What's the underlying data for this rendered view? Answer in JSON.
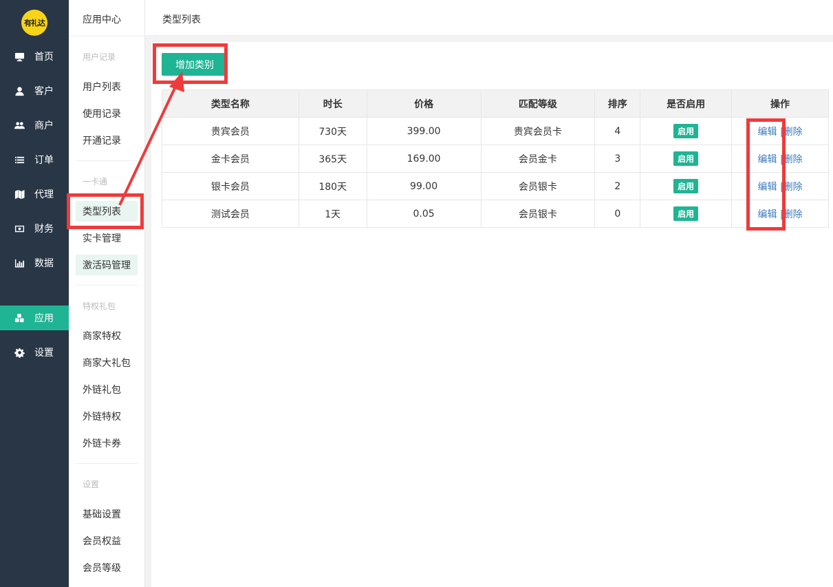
{
  "logo_text": "有礼达",
  "nav": {
    "items": [
      {
        "label": "首页",
        "icon": "monitor-icon"
      },
      {
        "label": "客户",
        "icon": "user-icon"
      },
      {
        "label": "商户",
        "icon": "users-icon"
      },
      {
        "label": "订单",
        "icon": "list-icon"
      },
      {
        "label": "代理",
        "icon": "map-icon"
      },
      {
        "label": "财务",
        "icon": "money-icon"
      },
      {
        "label": "数据",
        "icon": "bar-chart-icon"
      },
      {
        "label": "应用",
        "icon": "cubes-icon"
      },
      {
        "label": "设置",
        "icon": "gear-icon"
      }
    ]
  },
  "submenu": {
    "title": "应用中心",
    "groups": {
      "user_records": "用户记录",
      "card": "一卡通",
      "privilege": "特权礼包",
      "settings": "设置"
    },
    "items": [
      "用户列表",
      "使用记录",
      "开通记录",
      "类型列表",
      "实卡管理",
      "激活码管理",
      "商家特权",
      "商家大礼包",
      "外链礼包",
      "外链特权",
      "外链卡券",
      "基础设置",
      "会员权益",
      "会员等级"
    ]
  },
  "topbar": {
    "title": "类型列表"
  },
  "add_button": "增加类别",
  "table": {
    "headers": [
      "类型名称",
      "时长",
      "价格",
      "匹配等级",
      "排序",
      "是否启用",
      "操作"
    ],
    "rows": [
      {
        "name": "贵宾会员",
        "duration": "730天",
        "price": "399.00",
        "level": "贵宾会员卡",
        "sort": "4",
        "status": "启用"
      },
      {
        "name": "金卡会员",
        "duration": "365天",
        "price": "169.00",
        "level": "会员金卡",
        "sort": "3",
        "status": "启用"
      },
      {
        "name": "银卡会员",
        "duration": "180天",
        "price": "99.00",
        "level": "会员银卡",
        "sort": "2",
        "status": "启用"
      },
      {
        "name": "测试会员",
        "duration": "1天",
        "price": "0.05",
        "level": "会员银卡",
        "sort": "0",
        "status": "启用"
      }
    ],
    "edit_label": "编辑",
    "delete_label": "删除",
    "op_separator": "|"
  },
  "colors": {
    "accent": "#1fb494",
    "nav_bg": "#283646",
    "annotation": "#ee3b3b",
    "link": "#3b7bbf"
  }
}
